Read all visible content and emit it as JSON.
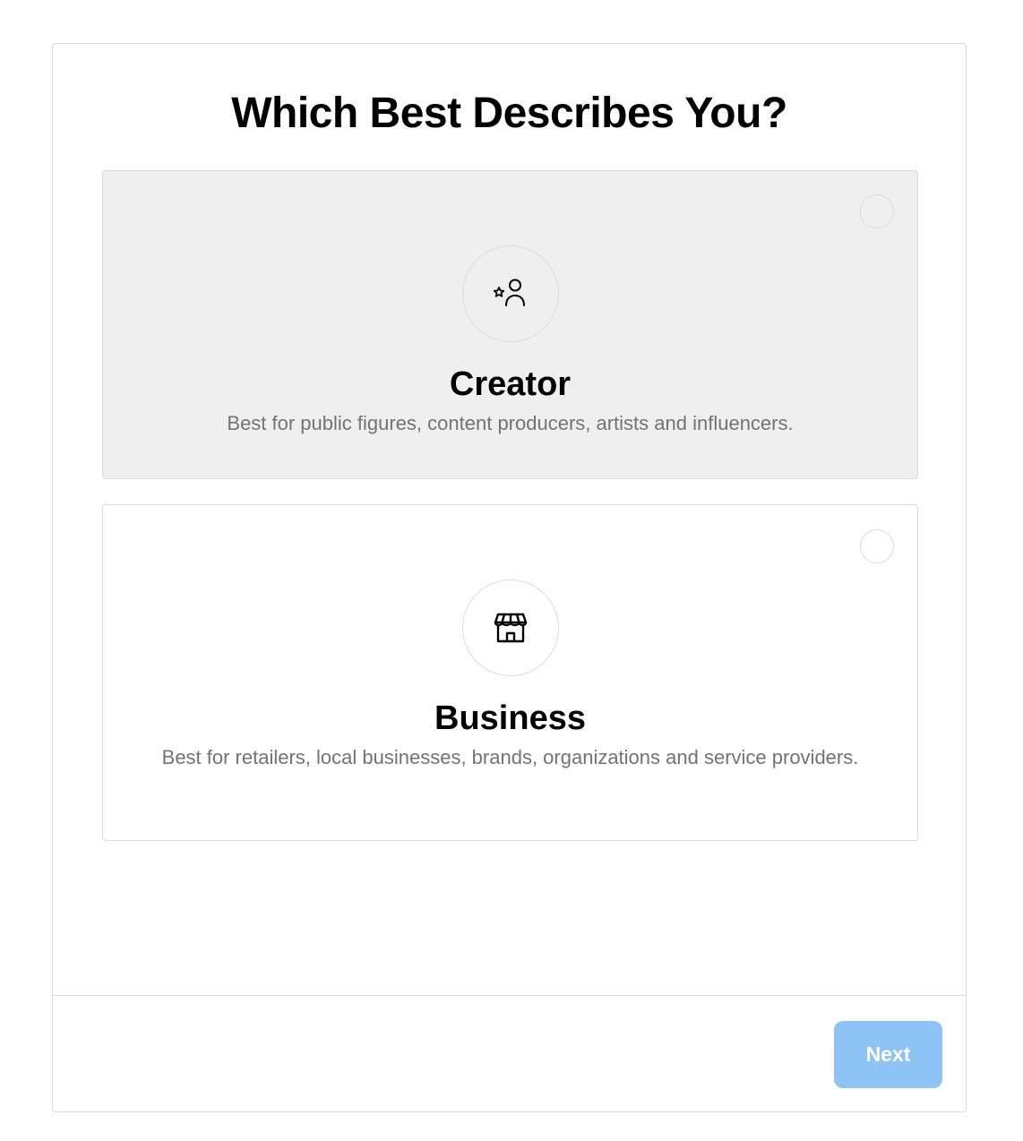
{
  "dialog": {
    "title": "Which Best Describes You?"
  },
  "options": [
    {
      "id": "creator",
      "title": "Creator",
      "description": "Best for public figures, content producers, artists and influencers.",
      "icon": "creator-person-star-icon",
      "selected": false,
      "highlighted": true
    },
    {
      "id": "business",
      "title": "Business",
      "description": "Best for retailers, local businesses, brands, organizations and service providers.",
      "icon": "storefront-icon",
      "selected": false,
      "highlighted": false
    }
  ],
  "footer": {
    "next_label": "Next",
    "next_enabled": false,
    "next_color": "#8ec3f6"
  }
}
